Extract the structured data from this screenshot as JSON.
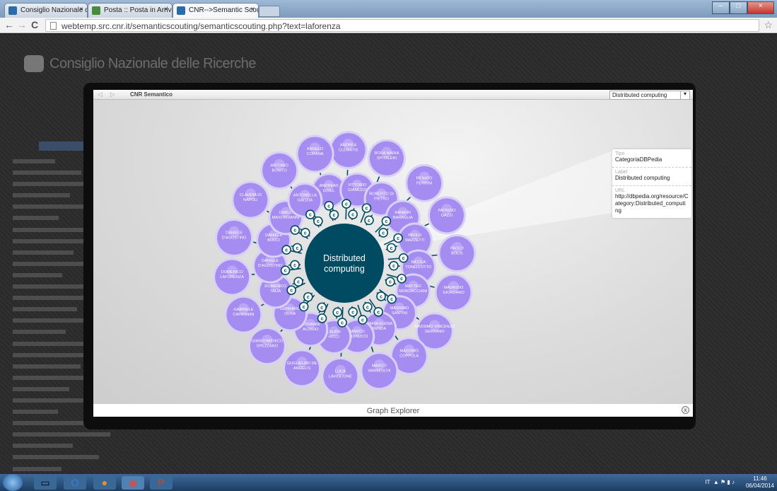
{
  "browser": {
    "tabs": [
      {
        "title": "Consiglio Nazionale delle",
        "icon": "cnr-favicon-icon",
        "color": "#2b6ca8",
        "active": false
      },
      {
        "title": "Posta :: Posta in Arrivo: Fo",
        "icon": "mail-favicon-icon",
        "color": "#4a8b3a",
        "active": false
      },
      {
        "title": "CNR-->Semantic Scouting",
        "icon": "cnr-favicon-icon",
        "color": "#2b6ca8",
        "active": true
      }
    ],
    "url": "webtemp.src.cnr.it/semanticscouting/semanticscouting.php?text=laforenza",
    "back_icon": "←",
    "forward_icon": "→",
    "reload_icon": "C",
    "star_icon": "☆"
  },
  "site": {
    "title": "Consiglio Nazionale delle Ricerche"
  },
  "viewer": {
    "title": "CNR Semantico",
    "selected_topic": "Distributed computing",
    "footer": "Graph Explorer",
    "close_glyph": "x"
  },
  "info": {
    "tipo_label": "Tipo",
    "tipo_value": "CategoriaDBPedia",
    "label_label": "Label",
    "label_value": "Distributed computing",
    "url_label": "URL",
    "url_value": "http://dbpedia.org/resource/Category:Distributed_computing"
  },
  "graph": {
    "center": "Distributed computing",
    "connector_glyph": "c",
    "node_color": "#a58cf0",
    "center_color": "#004a62",
    "people": [
      {
        "name": "ANDREA CLEMATIS",
        "ring": 3,
        "angle": -88
      },
      {
        "name": "ROSA MARIA SPITALERI",
        "ring": 3,
        "angle": -68
      },
      {
        "name": "RENATO FERRINI",
        "ring": 3,
        "angle": -45
      },
      {
        "name": "PATRIZIO DAZZI",
        "ring": 3,
        "angle": -25
      },
      {
        "name": "PAOLO BOLIS",
        "ring": 3,
        "angle": -5
      },
      {
        "name": "MAURIZIO GIORDANO",
        "ring": 3,
        "angle": 15
      },
      {
        "name": "MASSIMO VINCENZO SERRANO",
        "ring": 3,
        "angle": 37
      },
      {
        "name": "MASSIMO COPPOLA",
        "ring": 3,
        "angle": 55
      },
      {
        "name": "MARCO VANNESCHI",
        "ring": 3,
        "angle": 72
      },
      {
        "name": "LUCA LAVIGLIONE",
        "ring": 3,
        "angle": 92
      },
      {
        "name": "GUGLIELMO DE ANGELIS",
        "ring": 3,
        "angle": 112
      },
      {
        "name": "GIANDOMENICO SPEZZANO",
        "ring": 3,
        "angle": 133
      },
      {
        "name": "GABRIELE CAPANNINI",
        "ring": 3,
        "angle": 153
      },
      {
        "name": "DOMENICO LAFORENZA",
        "ring": 3,
        "angle": 173
      },
      {
        "name": "DANIELE D'AGOSTINO",
        "ring": 3,
        "angle": -167
      },
      {
        "name": "CLAUDIA DI NAPOLI",
        "ring": 3,
        "angle": -146
      },
      {
        "name": "ANTONIO BONITO",
        "ring": 3,
        "angle": -125
      },
      {
        "name": "ANGELO CORANA",
        "ring": 3,
        "angle": -105
      },
      {
        "name": "ANDREAS GISEL",
        "ring": 2,
        "angle": -102
      },
      {
        "name": "VITTORIO GIANUZZI",
        "ring": 2,
        "angle": -80
      },
      {
        "name": "ROBERTO DI PIETRO",
        "ring": 2,
        "angle": -60
      },
      {
        "name": "RANIERI BARAGLIA",
        "ring": 2,
        "angle": -38
      },
      {
        "name": "PAOLO MAZZETTI",
        "ring": 2,
        "angle": -18
      },
      {
        "name": "NICOLA TONELLOTTO",
        "ring": 2,
        "angle": 3
      },
      {
        "name": "MATTEO MORDACCHINI",
        "ring": 2,
        "angle": 22
      },
      {
        "name": "MASSIMO SANTINI",
        "ring": 2,
        "angle": 42
      },
      {
        "name": "MARIA ELENA RENDA",
        "ring": 2,
        "angle": 62
      },
      {
        "name": "MARCO ALDINUCCI",
        "ring": 2,
        "angle": 80
      },
      {
        "name": "LAURA RICCI",
        "ring": 2,
        "angle": 98
      },
      {
        "name": "GIOVANNI ALOISIO",
        "ring": 2,
        "angle": 117
      },
      {
        "name": "GENNARO OLIVA",
        "ring": 2,
        "angle": 137
      },
      {
        "name": "DOMENICO TALIA",
        "ring": 2,
        "angle": 158
      },
      {
        "name": "DANIELE D'AGOSTINO",
        "ring": 2,
        "angle": 178
      },
      {
        "name": "DANIELE BOCCI",
        "ring": 2,
        "angle": -162
      },
      {
        "name": "CARLO MASTROIANNI",
        "ring": 2,
        "angle": -142
      },
      {
        "name": "ANTONELLA GALIZIA",
        "ring": 2,
        "angle": -122
      }
    ]
  },
  "taskbar": {
    "lang": "IT",
    "time": "11:46",
    "date": "06/04/2014"
  }
}
